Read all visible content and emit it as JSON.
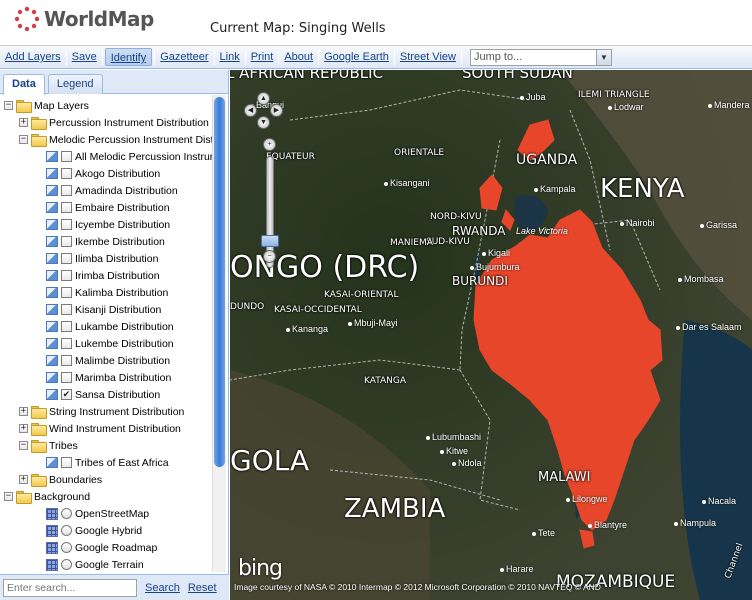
{
  "header": {
    "logo_text": "WorldMap",
    "current_map_label": "Current Map: Singing Wells"
  },
  "toolbar": {
    "items": [
      "Add Layers",
      "Save",
      "Identify",
      "Gazetteer",
      "Link",
      "Print",
      "About",
      "Google Earth",
      "Street View"
    ],
    "jump_placeholder": "Jump to..."
  },
  "sidebar": {
    "tabs": [
      "Data",
      "Legend"
    ],
    "tree": [
      {
        "label": "Map Layers",
        "kind": "folder",
        "exp": "−",
        "indent": 0
      },
      {
        "label": "Percussion Instrument Distribution",
        "kind": "folder",
        "exp": "+",
        "indent": 1
      },
      {
        "label": "Melodic Percussion Instrument Distribution",
        "kind": "folder",
        "exp": "−",
        "indent": 1
      },
      {
        "label": "All Melodic Percussion Instruments",
        "kind": "layer",
        "checked": false,
        "indent": 2
      },
      {
        "label": "Akogo Distribution",
        "kind": "layer",
        "checked": false,
        "indent": 2
      },
      {
        "label": "Amadinda Distribution",
        "kind": "layer",
        "checked": false,
        "indent": 2
      },
      {
        "label": "Embaire Distribution",
        "kind": "layer",
        "checked": false,
        "indent": 2
      },
      {
        "label": "Icyembe Distribution",
        "kind": "layer",
        "checked": false,
        "indent": 2
      },
      {
        "label": "Ikembe Distribution",
        "kind": "layer",
        "checked": false,
        "indent": 2
      },
      {
        "label": "Ilimba Distribution",
        "kind": "layer",
        "checked": false,
        "indent": 2
      },
      {
        "label": "Irimba Distribution",
        "kind": "layer",
        "checked": false,
        "indent": 2
      },
      {
        "label": "Kalimba Distribution",
        "kind": "layer",
        "checked": false,
        "indent": 2
      },
      {
        "label": "Kisanji Distribution",
        "kind": "layer",
        "checked": false,
        "indent": 2
      },
      {
        "label": "Lukambe Distribution",
        "kind": "layer",
        "checked": false,
        "indent": 2
      },
      {
        "label": "Lukembe Distribution",
        "kind": "layer",
        "checked": false,
        "indent": 2
      },
      {
        "label": "Malimbe Distribution",
        "kind": "layer",
        "checked": false,
        "indent": 2
      },
      {
        "label": "Marimba Distribution",
        "kind": "layer",
        "checked": false,
        "indent": 2
      },
      {
        "label": "Sansa Distribution",
        "kind": "layer",
        "checked": true,
        "indent": 2
      },
      {
        "label": "String Instrument Distribution",
        "kind": "folder",
        "exp": "+",
        "indent": 1
      },
      {
        "label": "Wind Instrument Distribution",
        "kind": "folder",
        "exp": "+",
        "indent": 1
      },
      {
        "label": "Tribes",
        "kind": "folder",
        "exp": "−",
        "indent": 1
      },
      {
        "label": "Tribes of East Africa",
        "kind": "layer",
        "checked": false,
        "indent": 2
      },
      {
        "label": "Boundaries",
        "kind": "folder",
        "exp": "+",
        "indent": 1
      },
      {
        "label": "Background",
        "kind": "folder",
        "exp": "−",
        "indent": 0
      },
      {
        "label": "OpenStreetMap",
        "kind": "base",
        "indent": 2
      },
      {
        "label": "Google Hybrid",
        "kind": "base",
        "indent": 2
      },
      {
        "label": "Google Roadmap",
        "kind": "base",
        "indent": 2
      },
      {
        "label": "Google Terrain",
        "kind": "base",
        "indent": 2
      }
    ],
    "search_placeholder": "Enter search...",
    "search_label": "Search",
    "reset_label": "Reset"
  },
  "map": {
    "country_labels": [
      "UGANDA",
      "KENYA",
      "RWANDA",
      "BURUNDI",
      "ONGO (DRC)",
      "GOLA",
      "ZAMBIA",
      "MALAWI",
      "MOZAMBIQUE",
      "L AFRICAN REPUBLIC",
      "SOUTH SUDAN"
    ],
    "region_labels": [
      "ORIENTALE",
      "EQUATEUR",
      "NORD-KIVU",
      "SUD-KIVU",
      "MANIEMA",
      "KASAI-ORIENTAL",
      "KASAI-OCCIDENTAL",
      "KATANGA",
      "DUNDO",
      "ILEMI TRIANGLE"
    ],
    "cities": [
      "Bangui",
      "Kisangani",
      "Kampala",
      "Nairobi",
      "Kigali",
      "Bujumbura",
      "Mbuji-Mayi",
      "Kananga",
      "Lubumbashi",
      "Ndola",
      "Kitwe",
      "Lilongwe",
      "Blantyre",
      "Nampula",
      "Nacala",
      "Harare",
      "Tete",
      "Mombasa",
      "Dar es Salaam",
      "Lodwar",
      "Juba",
      "Lake Victoria",
      "Mandera",
      "Garissa"
    ],
    "bing_label": "bing",
    "attribution": "Image courtesy of NASA © 2010 Intermap © 2012 Microsoft Corporation © 2010 NAVTEQ © AND",
    "channel_label": "Channel",
    "overlay_color": "#e8462a"
  }
}
